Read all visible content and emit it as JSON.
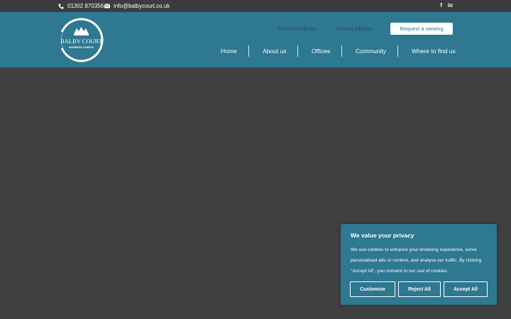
{
  "topbar": {
    "phone": "01302 870356",
    "email": "info@balbycourt.co.uk",
    "social": [
      {
        "name": "facebook",
        "glyph": "f"
      },
      {
        "name": "linkedin",
        "glyph": "in"
      }
    ]
  },
  "logo": {
    "line1": "BALBY COURT",
    "line2": "BUSINESS CAMPUS"
  },
  "secondary_nav": {
    "serviced": "Serviced Offices",
    "leased": "Leased Offices",
    "request": "Request a viewing"
  },
  "main_nav": [
    "Home",
    "About us",
    "Offices",
    "Community",
    "Where to find us"
  ],
  "cookie_banner": {
    "title": "We value your privacy",
    "body": "We use cookies to enhance your browsing experience, serve personalised ads or content, and analyse our traffic. By clicking \"Accept All\", you consent to our use of cookies.",
    "customise": "Customise",
    "reject": "Reject All",
    "accept": "Accept All"
  },
  "colors": {
    "brand_teal": "#2e7891",
    "page_bg": "#404042",
    "topbar_bg": "#3c3c3e"
  }
}
